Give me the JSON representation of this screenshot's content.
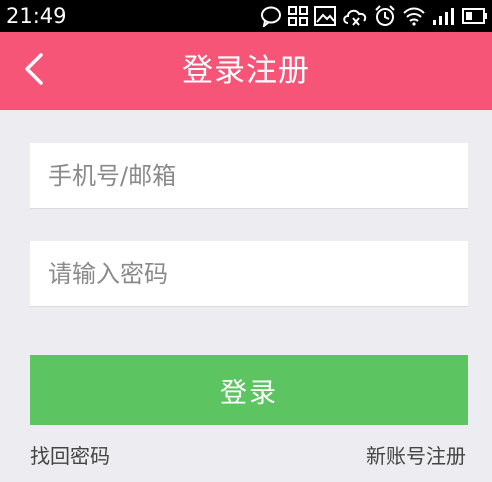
{
  "status_bar": {
    "time": "21:49"
  },
  "header": {
    "title": "登录注册",
    "back_icon": "chevron-left-icon"
  },
  "form": {
    "phone_placeholder": "手机号/邮箱",
    "phone_value": "",
    "password_placeholder": "请输入密码",
    "password_value": "",
    "login_label": "登录"
  },
  "links": {
    "forgot_password": "找回密码",
    "register": "新账号注册"
  },
  "colors": {
    "header_bg": "#f65577",
    "login_bg": "#5dc462",
    "page_bg": "#ececf1"
  }
}
